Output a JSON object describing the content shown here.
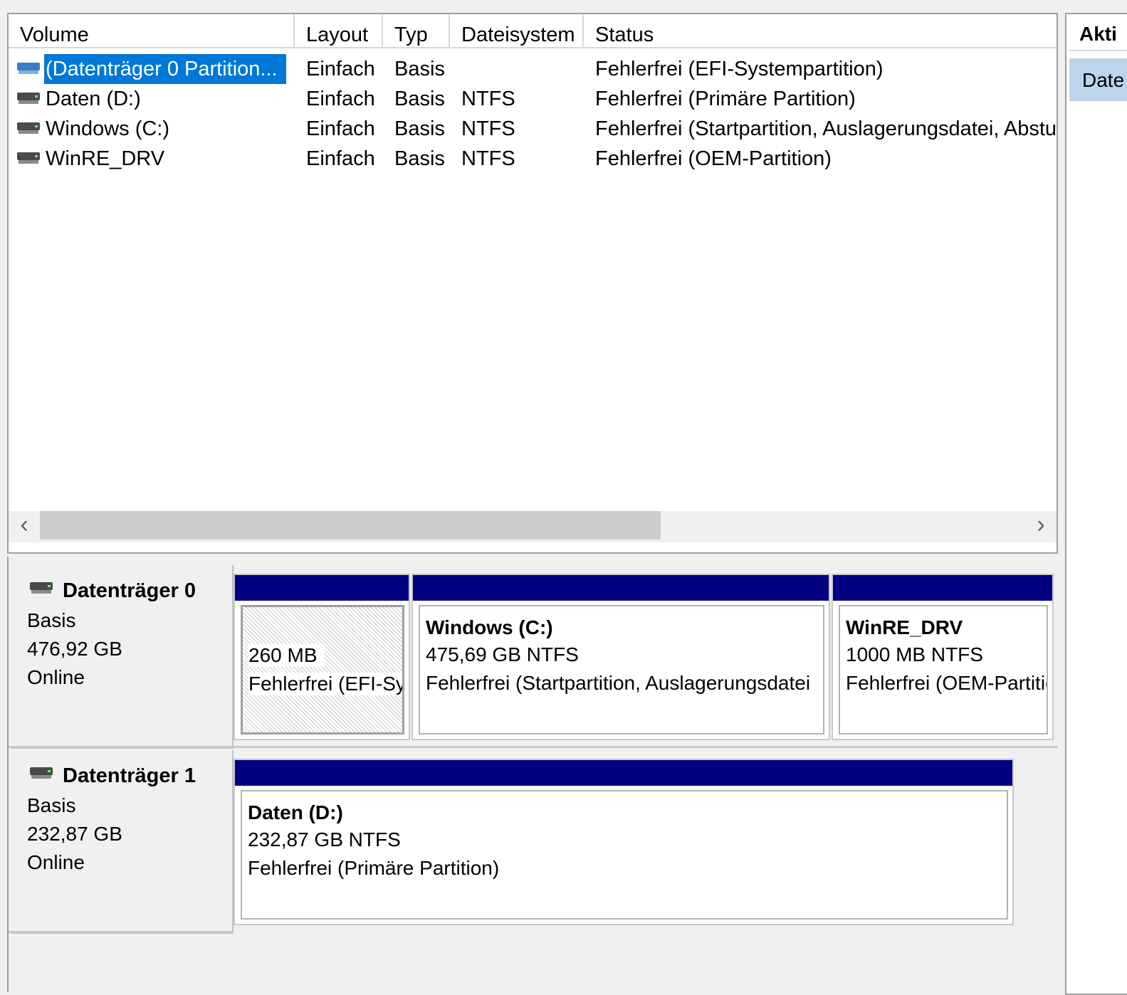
{
  "volume_list": {
    "columns": [
      "Volume",
      "Layout",
      "Typ",
      "Dateisystem",
      "Status"
    ],
    "rows": [
      {
        "volume": "(Datenträger 0 Partition...",
        "layout": "Einfach",
        "typ": "Basis",
        "fs": "",
        "status": "Fehlerfrei (EFI-Systempartition)"
      },
      {
        "volume": "Daten (D:)",
        "layout": "Einfach",
        "typ": "Basis",
        "fs": "NTFS",
        "status": "Fehlerfrei (Primäre Partition)"
      },
      {
        "volume": "Windows (C:)",
        "layout": "Einfach",
        "typ": "Basis",
        "fs": "NTFS",
        "status": "Fehlerfrei (Startpartition, Auslagerungsdatei, Absturzabbild"
      },
      {
        "volume": "WinRE_DRV",
        "layout": "Einfach",
        "typ": "Basis",
        "fs": "NTFS",
        "status": "Fehlerfrei (OEM-Partition)"
      }
    ],
    "scroll_left_icon": "chevron-left-icon",
    "scroll_right_icon": "chevron-right-icon"
  },
  "actions": {
    "title": "Akti",
    "item": "Date"
  },
  "disks": [
    {
      "name": "Datenträger 0",
      "type": "Basis",
      "size": "476,92 GB",
      "state": "Online",
      "partitions": [
        {
          "title": "",
          "size": "260 MB",
          "status": "Fehlerfrei (EFI-Systempartition)"
        },
        {
          "title": "Windows  (C:)",
          "size": "475,69 GB NTFS",
          "status": "Fehlerfrei (Startpartition, Auslagerungsdatei"
        },
        {
          "title": "WinRE_DRV",
          "size": "1000 MB NTFS",
          "status": "Fehlerfrei (OEM-Partition)"
        }
      ]
    },
    {
      "name": "Datenträger 1",
      "type": "Basis",
      "size": "232,87 GB",
      "state": "Online",
      "partitions": [
        {
          "title": "Daten  (D:)",
          "size": "232,87 GB NTFS",
          "status": "Fehlerfrei (Primäre Partition)"
        }
      ]
    }
  ],
  "colors": {
    "partition_bar": "#000080",
    "selection": "#0078d7",
    "actions_highlight": "#bcd4ec"
  }
}
